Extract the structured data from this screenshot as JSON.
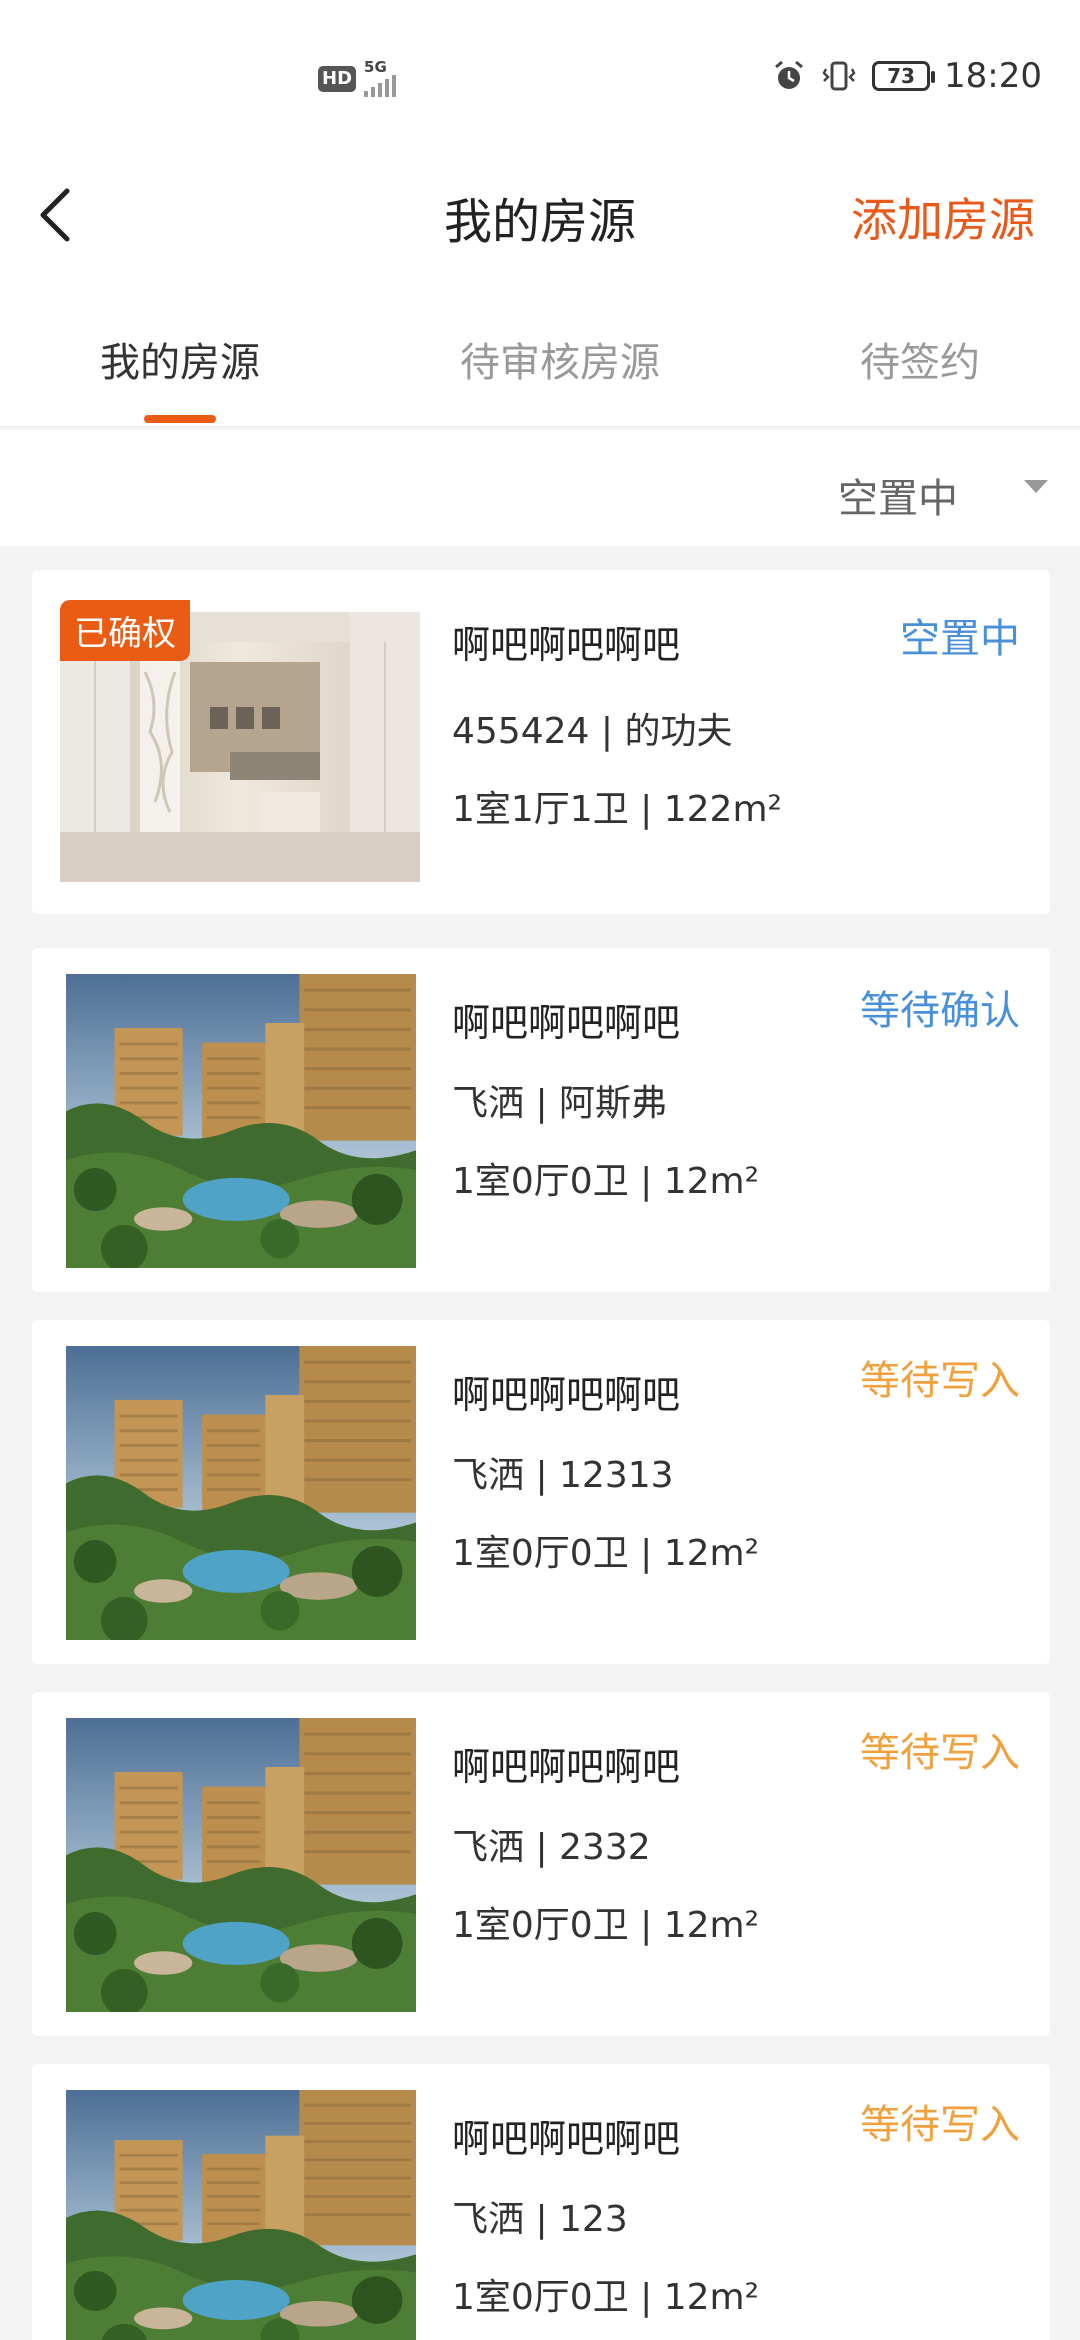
{
  "status_bar": {
    "hd": "HD",
    "network": "5G",
    "battery": "73",
    "time": "18:20"
  },
  "header": {
    "title": "我的房源",
    "add_label": "添加房源"
  },
  "tabs": [
    {
      "label": "我的房源",
      "active": true
    },
    {
      "label": "待审核房源",
      "active": false
    },
    {
      "label": "待签约",
      "active": false
    }
  ],
  "filter": {
    "selected": "空置中"
  },
  "listings": [
    {
      "badge": "已确权",
      "title": "啊吧啊吧啊吧",
      "sub": "455424 | 的功夫",
      "spec": "1室1厅1卫 | 122m²",
      "status": "空置中",
      "status_color": "#4a90d9",
      "image": "interior-room"
    },
    {
      "badge": "",
      "title": "啊吧啊吧啊吧",
      "sub": "飞洒 | 阿斯弗",
      "spec": "1室0厅0卫 | 12m²",
      "status": "等待确认",
      "status_color": "#4a90d9",
      "image": "apartment-complex"
    },
    {
      "badge": "",
      "title": "啊吧啊吧啊吧",
      "sub": "飞洒 | 12313",
      "spec": "1室0厅0卫 | 12m²",
      "status": "等待写入",
      "status_color": "#f0a03c",
      "image": "apartment-complex"
    },
    {
      "badge": "",
      "title": "啊吧啊吧啊吧",
      "sub": "飞洒 | 2332",
      "spec": "1室0厅0卫 | 12m²",
      "status": "等待写入",
      "status_color": "#f0a03c",
      "image": "apartment-complex"
    },
    {
      "badge": "",
      "title": "啊吧啊吧啊吧",
      "sub": "飞洒 | 123",
      "spec": "1室0厅0卫 | 12m²",
      "status": "等待写入",
      "status_color": "#f0a03c",
      "image": "apartment-complex"
    }
  ]
}
